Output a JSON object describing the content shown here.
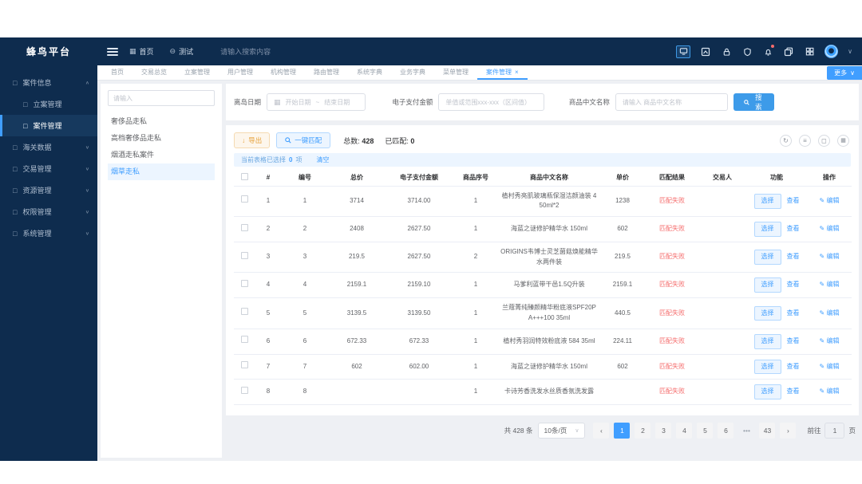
{
  "topbar": {
    "logo": "蜂鸟平台",
    "nav": [
      {
        "label": "首页"
      },
      {
        "label": "测试"
      }
    ],
    "search_placeholder": "请输入搜索内容"
  },
  "sidebar": {
    "items": [
      {
        "label": "案件信息",
        "state": "expanded",
        "children": [
          {
            "label": "立案管理",
            "active": false
          },
          {
            "label": "案件管理",
            "active": true
          }
        ]
      },
      {
        "label": "海关数据",
        "state": "collapsed"
      },
      {
        "label": "交易管理",
        "state": "collapsed"
      },
      {
        "label": "资源管理",
        "state": "collapsed"
      },
      {
        "label": "权限管理",
        "state": "collapsed"
      },
      {
        "label": "系统管理",
        "state": "collapsed"
      }
    ]
  },
  "tabs": {
    "items": [
      {
        "label": "首页",
        "active": false
      },
      {
        "label": "交易总览",
        "active": false
      },
      {
        "label": "立案管理",
        "active": false
      },
      {
        "label": "用户管理",
        "active": false
      },
      {
        "label": "机构管理",
        "active": false
      },
      {
        "label": "路由管理",
        "active": false
      },
      {
        "label": "系统字典",
        "active": false
      },
      {
        "label": "业务字典",
        "active": false
      },
      {
        "label": "菜单管理",
        "active": false
      },
      {
        "label": "案件管理",
        "active": true,
        "closable": true
      }
    ],
    "more_label": "更多"
  },
  "left_panel": {
    "search_placeholder": "请输入",
    "items": [
      {
        "label": "奢侈品走私",
        "active": false
      },
      {
        "label": "高档奢侈品走私",
        "active": false
      },
      {
        "label": "烟酒走私案件",
        "active": false
      },
      {
        "label": "烟草走私",
        "active": true
      }
    ]
  },
  "filters": {
    "date_label": "离岛日期",
    "date_start_placeholder": "开始日期",
    "date_separator": "~",
    "date_end_placeholder": "结束日期",
    "amount_label": "电子支付金额",
    "amount_placeholder": "单值或范围xxx-xxx（区间值）",
    "name_label": "商品中文名称",
    "name_placeholder": "请输入 商品中文名称",
    "search_label": "搜索"
  },
  "toolbar": {
    "export_label": "导出",
    "match_label": "一键匹配",
    "total_label": "总数:",
    "total_value": "428",
    "matched_label": "已匹配:",
    "matched_value": "0"
  },
  "selection_bar": {
    "prefix": "当前表格已选择",
    "count": "0",
    "suffix": "项",
    "clear_label": "清空"
  },
  "table": {
    "columns": [
      "#",
      "编号",
      "总价",
      "电子支付金额",
      "商品序号",
      "商品中文名称",
      "单价",
      "匹配结果",
      "交易人",
      "功能",
      "操作"
    ],
    "select_label": "选择",
    "view_label": "查看",
    "edit_label": "编辑",
    "rows": [
      {
        "num": "1",
        "code": "1",
        "total": "3714",
        "payment": "3714.00",
        "serial": "1",
        "name": "植村秀亮肌玻璃瓶保湿洁颜油装 450ml*2",
        "price": "1238",
        "result": "匹配失败",
        "trader": ""
      },
      {
        "num": "2",
        "code": "2",
        "total": "2408",
        "payment": "2627.50",
        "serial": "1",
        "name": "海蓝之谜修护精华水 150ml",
        "price": "602",
        "result": "匹配失败",
        "trader": ""
      },
      {
        "num": "3",
        "code": "3",
        "total": "219.5",
        "payment": "2627.50",
        "serial": "2",
        "name": "ORIGINS韦博士灵芝菌菇焕能精华水两件装",
        "price": "219.5",
        "result": "匹配失败",
        "trader": ""
      },
      {
        "num": "4",
        "code": "4",
        "total": "2159.1",
        "payment": "2159.10",
        "serial": "1",
        "name": "马爹利蓝带干邑1.5Q升装",
        "price": "2159.1",
        "result": "匹配失败",
        "trader": ""
      },
      {
        "num": "5",
        "code": "5",
        "total": "3139.5",
        "payment": "3139.50",
        "serial": "1",
        "name": "兰蔻菁纯臻颜精华粉底液SPF20PA+++100 35ml",
        "price": "440.5",
        "result": "匹配失败",
        "trader": ""
      },
      {
        "num": "6",
        "code": "6",
        "total": "672.33",
        "payment": "672.33",
        "serial": "1",
        "name": "植村秀羽润特效粉底液 584 35ml",
        "price": "224.11",
        "result": "匹配失败",
        "trader": ""
      },
      {
        "num": "7",
        "code": "7",
        "total": "602",
        "payment": "602.00",
        "serial": "1",
        "name": "海蓝之谜修护精华水 150ml",
        "price": "602",
        "result": "匹配失败",
        "trader": ""
      },
      {
        "num": "8",
        "code": "8",
        "total": "",
        "payment": "",
        "serial": "1",
        "name": "卡诗芳香洗发水丝质香氛洗发露",
        "price": "",
        "result": "匹配失败",
        "trader": ""
      }
    ]
  },
  "pagination": {
    "total_text": "共 428 条",
    "page_size": "10条/页",
    "pages": [
      "1",
      "2",
      "3",
      "4",
      "5",
      "6",
      "...",
      "43"
    ],
    "active_page": "1",
    "goto_prefix": "前往",
    "goto_value": "1",
    "goto_suffix": "页"
  },
  "icons": {
    "hamburger": "menu",
    "home_nav": "▦",
    "test_nav": "⊖",
    "calendar": "▦",
    "sidebar_item": "□",
    "collapsed_caret": "∨",
    "expanded_caret": "∧",
    "refresh": "↻",
    "density": "≡",
    "fullscreen": "◻",
    "column_settings": "▦",
    "export_arrow": "↓",
    "edit_pencil": "✎",
    "more_caret": "∨"
  }
}
